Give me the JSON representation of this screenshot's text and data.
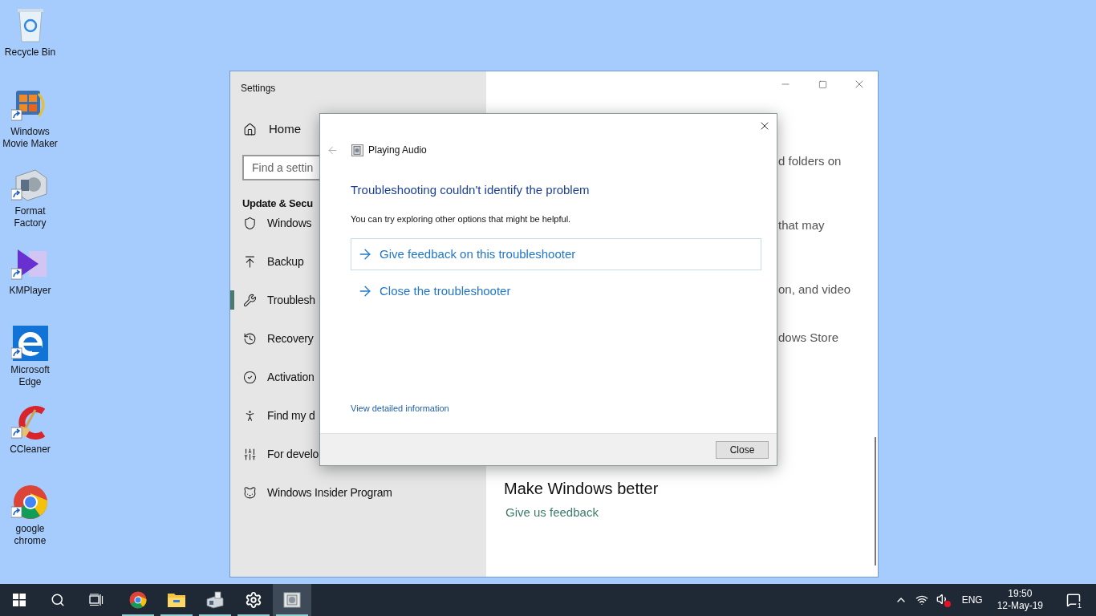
{
  "desktop_icons": [
    {
      "label": "Recycle Bin",
      "kind": "recycle-bin",
      "shortcut": false
    },
    {
      "label": "Windows Movie Maker",
      "kind": "movie-maker",
      "shortcut": true
    },
    {
      "label": "Format Factory",
      "kind": "format-factory",
      "shortcut": true
    },
    {
      "label": "KMPlayer",
      "kind": "kmplayer",
      "shortcut": true
    },
    {
      "label": "Microsoft Edge",
      "kind": "edge",
      "shortcut": true
    },
    {
      "label": "CCleaner",
      "kind": "ccleaner",
      "shortcut": true
    },
    {
      "label": "google chrome",
      "kind": "chrome",
      "shortcut": true
    }
  ],
  "settings_window": {
    "title": "Settings",
    "home": "Home",
    "search": {
      "placeholder": "Find a settin"
    },
    "section_title": "Update & Secu",
    "nav_items": [
      {
        "label": "Windows",
        "kind": "shield",
        "selected": false
      },
      {
        "label": "Backup",
        "kind": "backup",
        "selected": false
      },
      {
        "label": "Troublesh",
        "kind": "wrench",
        "selected": true
      },
      {
        "label": "Recovery",
        "kind": "history",
        "selected": false
      },
      {
        "label": "Activation",
        "kind": "check",
        "selected": false
      },
      {
        "label": "Find my d",
        "kind": "person",
        "selected": false
      },
      {
        "label": "For develo",
        "kind": "tools",
        "selected": false
      },
      {
        "label": "Windows Insider Program",
        "kind": "cat",
        "selected": false
      }
    ],
    "content_lines": [
      "d folders on",
      "that may",
      "on, and video",
      "dows Store"
    ],
    "feedback": {
      "heading": "Make Windows better",
      "link": "Give us feedback"
    }
  },
  "dialog": {
    "title": "Playing Audio",
    "heading": "Troubleshooting couldn't identify the problem",
    "message": "You can try exploring other options that might be helpful.",
    "options": [
      {
        "label": "Give feedback on this troubleshooter",
        "selected": true
      },
      {
        "label": "Close the troubleshooter",
        "selected": false
      }
    ],
    "details_link": "View detailed information",
    "buttons": [
      "Close"
    ]
  },
  "taskbar": {
    "apps": [
      {
        "kind": "start",
        "running": false,
        "selected": false
      },
      {
        "kind": "search",
        "running": false,
        "selected": false
      },
      {
        "kind": "task-view",
        "running": false,
        "selected": false
      },
      {
        "kind": "chrome",
        "running": true,
        "selected": false
      },
      {
        "kind": "folder",
        "running": true,
        "selected": false
      },
      {
        "kind": "machine",
        "running": true,
        "selected": false
      },
      {
        "kind": "settings",
        "running": true,
        "selected": false
      },
      {
        "kind": "troubleshooter",
        "running": true,
        "selected": true
      }
    ],
    "tray": {
      "language": "ENG",
      "time": "19:50",
      "date": "12-May-19",
      "notifications": "1"
    }
  }
}
